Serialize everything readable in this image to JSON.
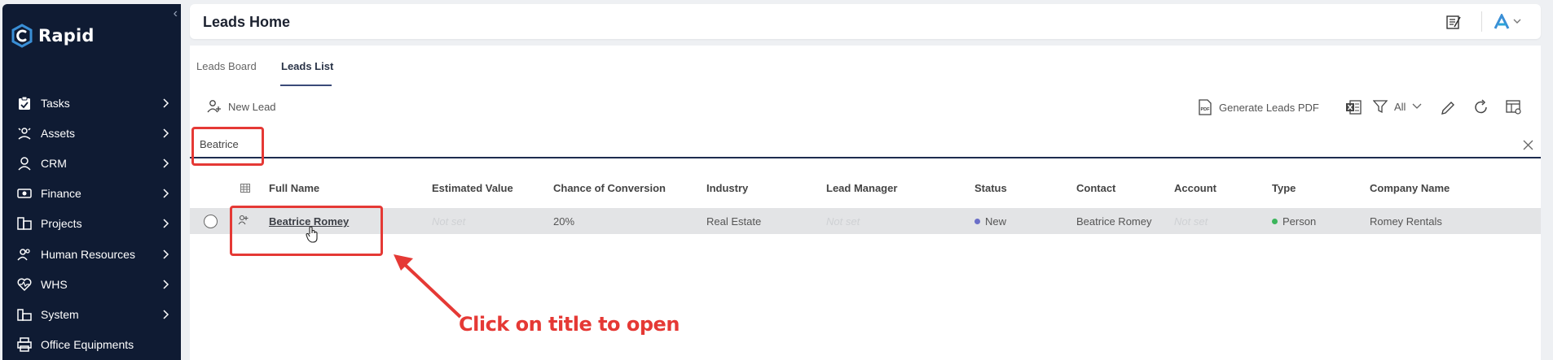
{
  "sidebar": {
    "logo_text": "Rapid",
    "items": [
      {
        "label": "Tasks",
        "icon": "clipboard-icon"
      },
      {
        "label": "Assets",
        "icon": "assets-icon"
      },
      {
        "label": "CRM",
        "icon": "user-icon"
      },
      {
        "label": "Finance",
        "icon": "cash-icon"
      },
      {
        "label": "Projects",
        "icon": "projects-icon"
      },
      {
        "label": "Human Resources",
        "icon": "people-icon"
      },
      {
        "label": "WHS",
        "icon": "heart-pulse-icon"
      },
      {
        "label": "System",
        "icon": "system-icon"
      },
      {
        "label": "Office Equipments",
        "icon": "printer-icon"
      }
    ]
  },
  "header": {
    "title": "Leads Home"
  },
  "tabs": [
    {
      "label": "Leads Board",
      "active": false
    },
    {
      "label": "Leads List",
      "active": true
    }
  ],
  "toolbar": {
    "new_lead": "New Lead",
    "generate_pdf": "Generate Leads PDF",
    "filter_value": "All"
  },
  "search": {
    "value": "Beatrice"
  },
  "table": {
    "columns": [
      "Full Name",
      "Estimated Value",
      "Chance of Conversion",
      "Industry",
      "Lead Manager",
      "Status",
      "Contact",
      "Account",
      "Type",
      "Company Name"
    ],
    "rows": [
      {
        "full_name": "Beatrice Romey",
        "estimated_value": "Not set",
        "chance_of_conversion": "20%",
        "industry": "Real Estate",
        "lead_manager": "Not set",
        "status": "New",
        "contact": "Beatrice Romey",
        "account": "Not set",
        "type": "Person",
        "company_name": "Romey Rentals"
      }
    ]
  },
  "annotation": {
    "text": "Click on title to open"
  },
  "colors": {
    "sidebar_bg": "#0f1b33",
    "accent": "#3a8fd6",
    "annotation": "#e53935",
    "status_new": "#6b6fc8",
    "type_person": "#3cb55c"
  }
}
